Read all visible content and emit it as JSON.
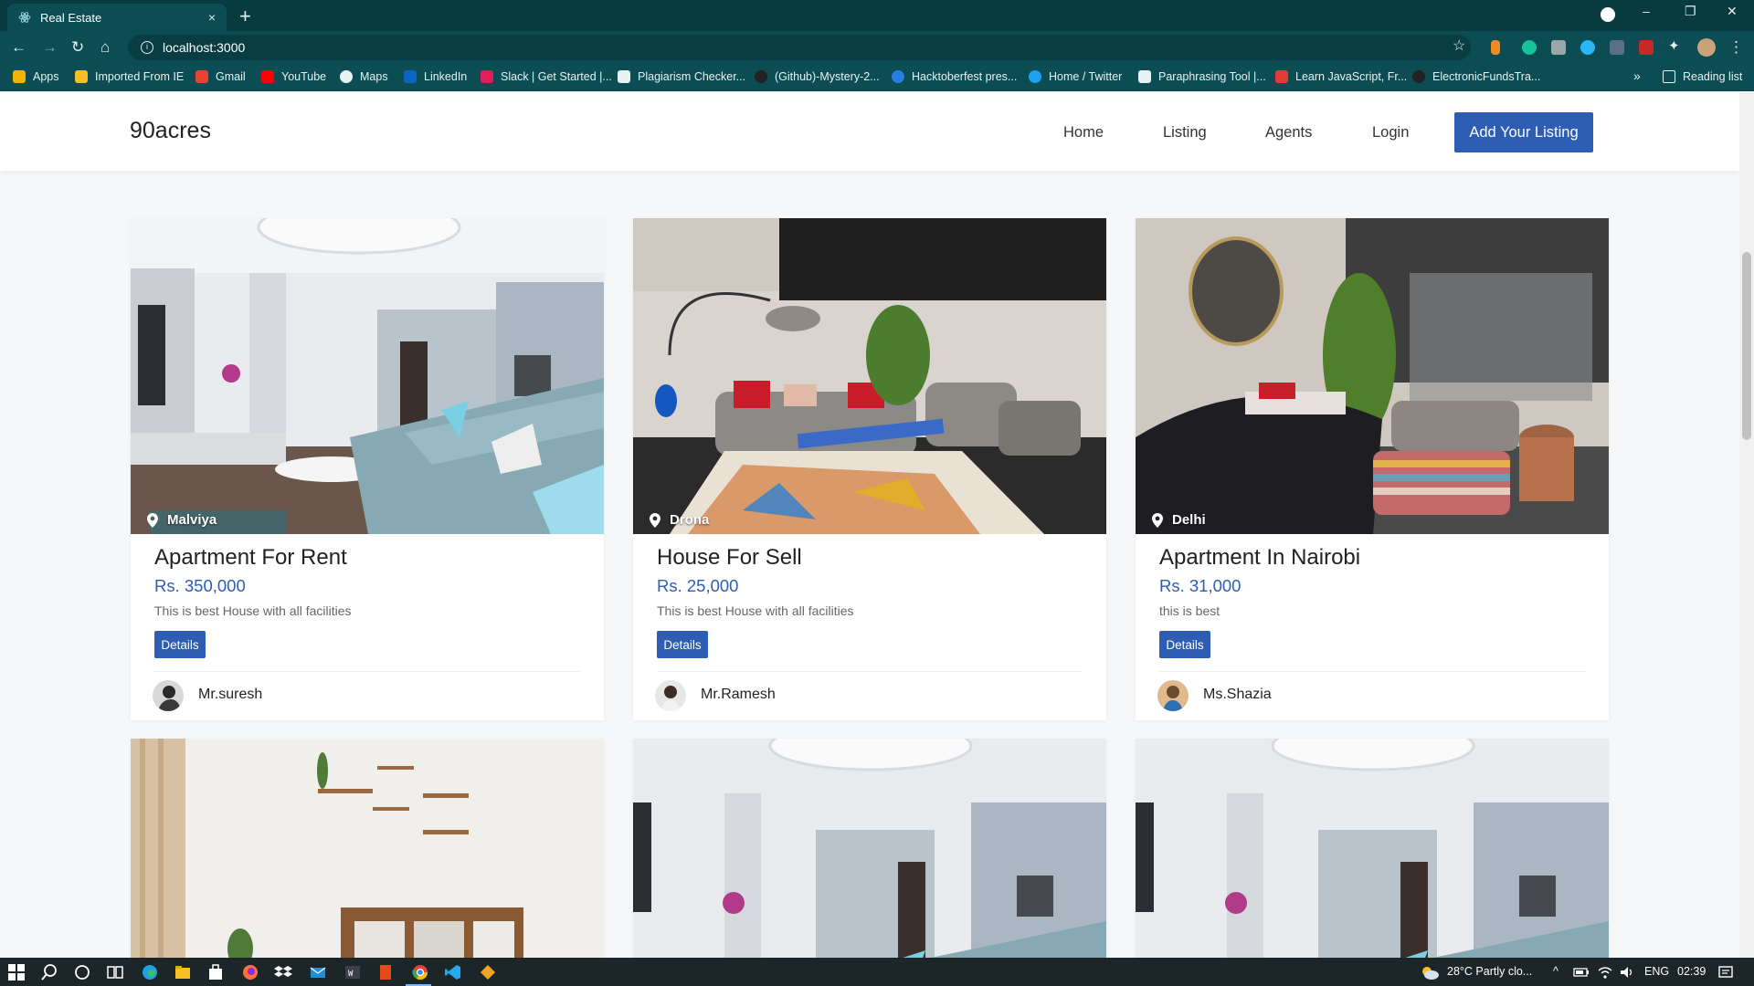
{
  "browser": {
    "tab_title": "Real Estate",
    "tab_close": "×",
    "new_tab": "+",
    "url": "localhost:3000",
    "window_controls": [
      "–",
      "❐",
      "✕"
    ],
    "nav_icons": [
      "←",
      "→",
      "↻",
      "⌂"
    ],
    "star": "☆",
    "menu": "⋮",
    "bookmarks": [
      {
        "label": "Apps",
        "icon": "apps-grid-icon",
        "color": "#f4b400"
      },
      {
        "label": "Imported From IE",
        "icon": "folder-icon",
        "color": "#f6c026"
      },
      {
        "label": "Gmail",
        "icon": "gmail-icon",
        "color": "#ea4335"
      },
      {
        "label": "YouTube",
        "icon": "youtube-icon",
        "color": "#ff0000"
      },
      {
        "label": "Maps",
        "icon": "maps-icon",
        "color": "#e8f2f2"
      },
      {
        "label": "LinkedIn",
        "icon": "linkedin-icon",
        "color": "#0a66c2"
      },
      {
        "label": "Slack | Get Started |...",
        "icon": "slack-icon",
        "color": "#e01e5a"
      },
      {
        "label": "Plagiarism Checker...",
        "icon": "plagiarism-icon",
        "color": "#e8f2f2"
      },
      {
        "label": "(Github)-Mystery-2...",
        "icon": "github-icon",
        "color": "#222222"
      },
      {
        "label": "Hacktoberfest pres...",
        "icon": "hacktoberfest-icon",
        "color": "#2a7de1"
      },
      {
        "label": "Home / Twitter",
        "icon": "twitter-icon",
        "color": "#1da1f2"
      },
      {
        "label": "Paraphrasing Tool |...",
        "icon": "pen-icon",
        "color": "#e8f2f2"
      },
      {
        "label": "Learn JavaScript, Fr...",
        "icon": "javascript-icon",
        "color": "#e53935"
      },
      {
        "label": "ElectronicFundsTra...",
        "icon": "github-icon",
        "color": "#222222"
      }
    ],
    "more_bookmarks": "»",
    "reading_list": "Reading list"
  },
  "site": {
    "brand": "90acres",
    "nav": [
      "Home",
      "Listing",
      "Agents",
      "Login"
    ],
    "cta": "Add Your Listing",
    "accent_color": "#2e5db4"
  },
  "listings": [
    {
      "location": "Malviya",
      "title": "Apartment For Rent",
      "price": "Rs. 350,000",
      "description": "This is best House with all facilities",
      "button": "Details",
      "agent": "Mr.suresh"
    },
    {
      "location": "Drona",
      "title": "House For Sell",
      "price": "Rs. 25,000",
      "description": "This is best House with all facilities",
      "button": "Details",
      "agent": "Mr.Ramesh"
    },
    {
      "location": "Delhi",
      "title": "Apartment In Nairobi",
      "price": "Rs. 31,000",
      "description": "this is best",
      "button": "Details",
      "agent": "Ms.Shazia"
    }
  ],
  "taskbar": {
    "weather": "28°C  Partly clo...",
    "language": "ENG",
    "time": "02:39"
  }
}
